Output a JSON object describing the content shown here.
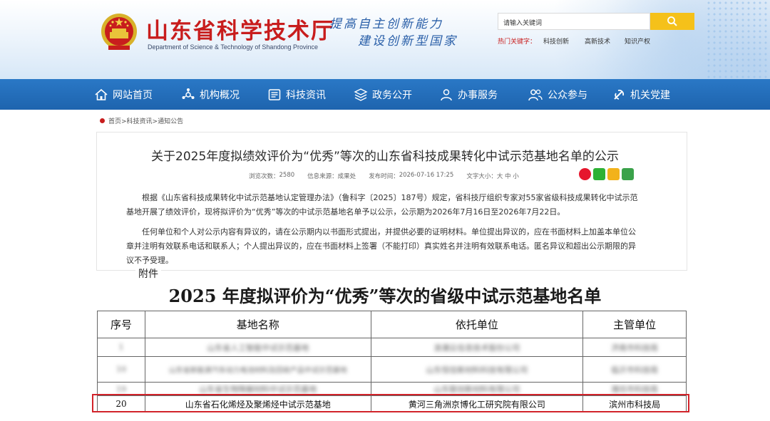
{
  "header": {
    "site_title": "山东省科学技术厅",
    "site_subtitle": "Department of Science & Technology of Shandong Province",
    "slogan_line1": "提高自主创新能力",
    "slogan_line2": "建设创新型国家",
    "search_placeholder": "请输入关键词",
    "hot_label": "热门关键字：",
    "hot_keywords": [
      "科技创新",
      "高新技术",
      "知识产权"
    ],
    "colors": {
      "title_red": "#c81d1d",
      "nav_blue": "#1e64ae",
      "search_yellow": "#f5c11a"
    }
  },
  "nav": [
    {
      "label": "网站首页",
      "icon": "home-icon"
    },
    {
      "label": "机构概况",
      "icon": "org-icon"
    },
    {
      "label": "科技资讯",
      "icon": "news-icon"
    },
    {
      "label": "政务公开",
      "icon": "layers-icon"
    },
    {
      "label": "办事服务",
      "icon": "user-icon"
    },
    {
      "label": "公众参与",
      "icon": "users-icon"
    },
    {
      "label": "机关党建",
      "icon": "party-icon"
    }
  ],
  "breadcrumb": "首页>科技资讯>通知公告",
  "article": {
    "title": "关于2025年度拟绩效评价为“优秀”等次的山东省科技成果转化中试示范基地名单的公示",
    "views_label": "浏览次数：",
    "views": "2580",
    "source_label": "信息来源：",
    "source": "成果处",
    "date_label": "发布时间：",
    "date": "2026-07-16 17:25",
    "fontsize_label": "文字大小：",
    "fontsize_options": "大 中 小",
    "paragraph1": [
      "根据《山东省科技成果转化中试示范基地认定管理办法》（鲁科字〔2025〕187号）规定，省科技厅组织专家对55家省级科技成果转化中试示范",
      "基地开展了绩效评价，现将拟评价为“优秀”等次的中试示范基地名单予以公示，公示期为2026年7月16日至2026年7月22日。"
    ],
    "paragraph2": [
      "任何单位和个人对公示内容有异议的，请在公示期内以书面形式提出，并提供必要的证明材料。单位提出异议的，应在书面材料上加盖本单位公",
      "章并注明有效联系电话和联系人；个人提出异议的，应在书面材料上签署（不能打印）真实姓名并注明有效联系电话。匿名异议和超出公示期限的异",
      "议不予受理。"
    ]
  },
  "attachment": {
    "label": "附件",
    "doc_title": "2025 年度拟评价为“优秀”等次的省级中试示范基地名单",
    "columns": [
      "序号",
      "基地名称",
      "依托单位",
      "主管单位"
    ],
    "rows": [
      {
        "no": "1",
        "name": "山东省人工智能中试示范基地",
        "org": "浪潮云信息技术股份公司",
        "dept": "济南市科技局",
        "blurred": true
      },
      {
        "no": "10",
        "name": "山东省新能源汽车动力电池材料及回收产品中试示范基地",
        "org": "山东恒信新材料科技有限公司",
        "dept": "临沂市科技局",
        "blurred": true
      },
      {
        "no": "19",
        "name": "山东省生物降解材料中试示范基地",
        "org": "山东联创新材料有限公司",
        "dept": "潍坊市科技局",
        "blurred": true
      },
      {
        "no": "20",
        "name": "山东省石化烯烃及聚烯烃中试示范基地",
        "org": "黄河三角洲京博化工研究院有限公司",
        "dept": "滨州市科技局",
        "blurred": false
      }
    ]
  }
}
